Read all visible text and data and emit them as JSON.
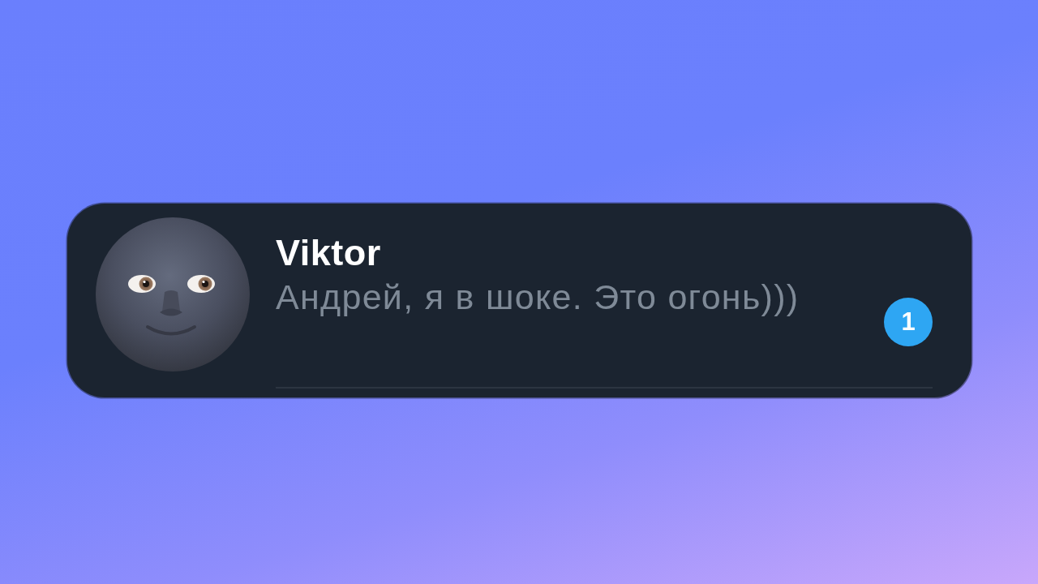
{
  "chats": [
    {
      "name": "Viktor",
      "message": "Андрей, я в шоке. Это огонь)))",
      "unread_count": "1"
    }
  ]
}
